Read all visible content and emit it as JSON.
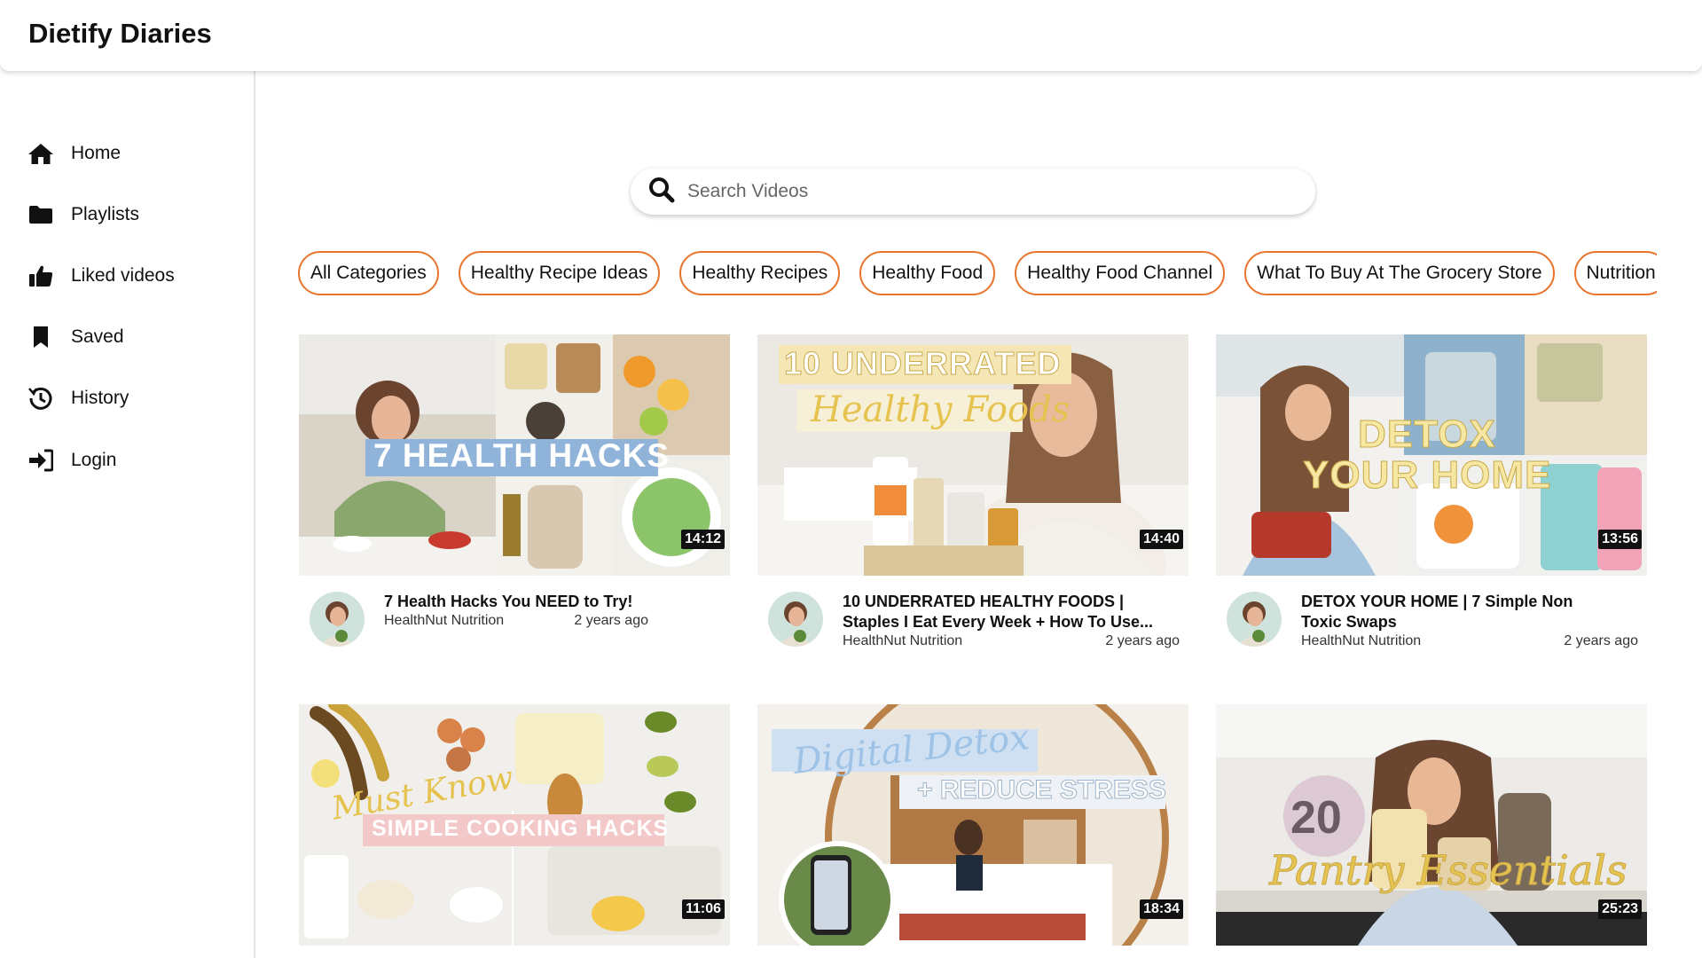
{
  "app": {
    "title": "Dietify Diaries"
  },
  "sidebar": {
    "items": [
      {
        "label": "Home",
        "icon": "home-icon"
      },
      {
        "label": "Playlists",
        "icon": "folder-icon"
      },
      {
        "label": "Liked videos",
        "icon": "thumbs-up-icon"
      },
      {
        "label": "Saved",
        "icon": "bookmark-icon"
      },
      {
        "label": "History",
        "icon": "history-icon"
      },
      {
        "label": "Login",
        "icon": "login-icon"
      }
    ]
  },
  "search": {
    "placeholder": "Search Videos",
    "value": ""
  },
  "categories": [
    "All Categories",
    "Healthy Recipe Ideas",
    "Healthy Recipes",
    "Healthy Food",
    "Healthy Food Channel",
    "What To Buy At The Grocery Store",
    "Nutrition"
  ],
  "colors": {
    "accent": "#e8732a"
  },
  "videos": [
    {
      "title": "7 Health Hacks You NEED to Try!",
      "thumb_text": [
        "7 HEALTH HACKS"
      ],
      "channel": "HealthNut Nutrition",
      "age": "2 years ago",
      "duration": "14:12"
    },
    {
      "title": "10 UNDERRATED HEALTHY FOODS | Staples I Eat Every Week + How To Use...",
      "thumb_text": [
        "10 UNDERRATED",
        "Healthy Foods"
      ],
      "channel": "HealthNut Nutrition",
      "age": "2 years ago",
      "duration": "14:40"
    },
    {
      "title": "DETOX YOUR HOME | 7 Simple Non Toxic Swaps",
      "thumb_text": [
        "DETOX",
        "YOUR HOME"
      ],
      "channel": "HealthNut Nutrition",
      "age": "2 years ago",
      "duration": "13:56"
    },
    {
      "title": "",
      "thumb_text": [
        "Must Know",
        "SIMPLE COOKING HACKS"
      ],
      "channel": "",
      "age": "",
      "duration": "11:06"
    },
    {
      "title": "",
      "thumb_text": [
        "Digital Detox",
        "+ REDUCE STRESS"
      ],
      "channel": "",
      "age": "",
      "duration": "18:34"
    },
    {
      "title": "",
      "thumb_text": [
        "20",
        "Pantry Essentials"
      ],
      "channel": "",
      "age": "",
      "duration": "25:23"
    }
  ]
}
